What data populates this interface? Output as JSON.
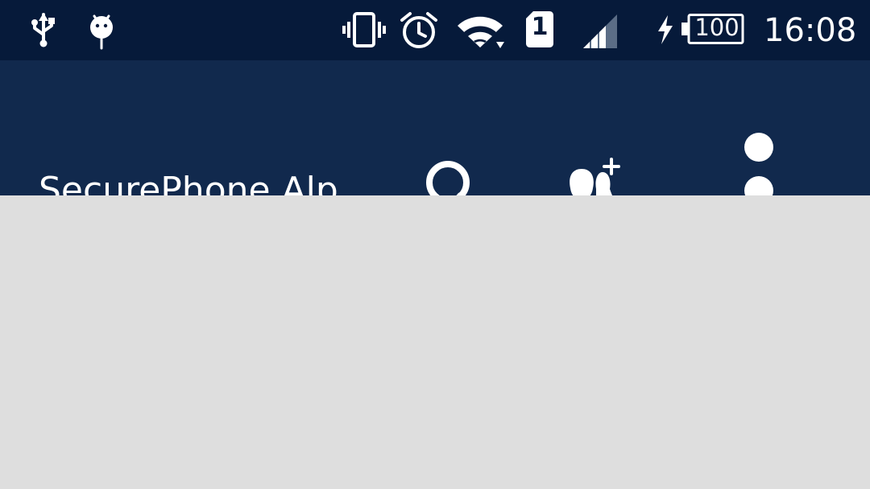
{
  "status_bar": {
    "time": "16:08",
    "battery_level": "100",
    "sim_slot": "1",
    "icons": [
      "usb-icon",
      "android-debug-icon",
      "vibrate-icon",
      "alarm-icon",
      "wifi-icon",
      "sim-card-icon",
      "cellular-signal-icon",
      "charging-icon",
      "battery-icon"
    ]
  },
  "app_bar": {
    "title": "SecurePhone Alp…",
    "actions": [
      "search-icon",
      "add-contact-icon",
      "more-options-icon"
    ]
  },
  "colors": {
    "status_bar": "#061a3a",
    "app_bar": "#11294d",
    "background": "#dedede",
    "foreground": "#ffffff"
  }
}
